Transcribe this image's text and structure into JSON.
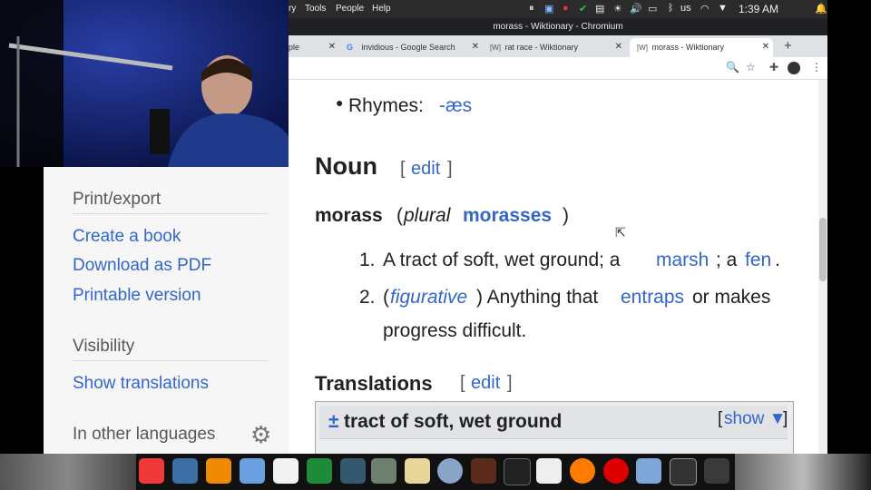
{
  "system": {
    "menus": [
      "ry",
      "Tools",
      "People",
      "Help"
    ],
    "keyboard": "us",
    "time": "1:39 AM"
  },
  "window": {
    "title": "morass - Wiktionary - Chromium"
  },
  "tabs": [
    {
      "label": "ple",
      "icon": ""
    },
    {
      "label": "invidious - Google Search",
      "icon": "G"
    },
    {
      "label": "rat race - Wiktionary",
      "icon": "[W]"
    },
    {
      "label": "morass - Wiktionary",
      "icon": "[W]"
    }
  ],
  "sidebar": {
    "print_heading": "Print/export",
    "print_links": [
      "Create a book",
      "Download as PDF",
      "Printable version"
    ],
    "visibility_heading": "Visibility",
    "visibility_links": [
      "Show translations"
    ],
    "languages_heading": "In other languages"
  },
  "article": {
    "rhymes_label": "Rhymes:",
    "rhymes_value": "-æs",
    "noun_heading": "Noun",
    "edit_open": "[",
    "edit_label": "edit",
    "edit_close": "]",
    "headword": "morass",
    "plural_open": "(",
    "plural_label": "plural",
    "plural_value": "morasses",
    "plural_close": ")",
    "senses": [
      {
        "num": "1.",
        "parts": [
          "A tract of soft, wet ground; a ",
          "marsh",
          "; a ",
          "fen",
          "."
        ]
      },
      {
        "num": "2.",
        "parts": [
          "(",
          "figurative",
          ") Anything that ",
          "entraps",
          " or makes",
          "progress difficult."
        ]
      }
    ],
    "translations_heading": "Translations",
    "translation_row": {
      "toggle": "±",
      "gloss": "tract of soft, wet ground",
      "show_open": "[",
      "show_label": "show ▼",
      "show_close": "]"
    }
  },
  "colors": {
    "link": "#3366cc",
    "sidebar_bg": "#f6f6f6"
  }
}
